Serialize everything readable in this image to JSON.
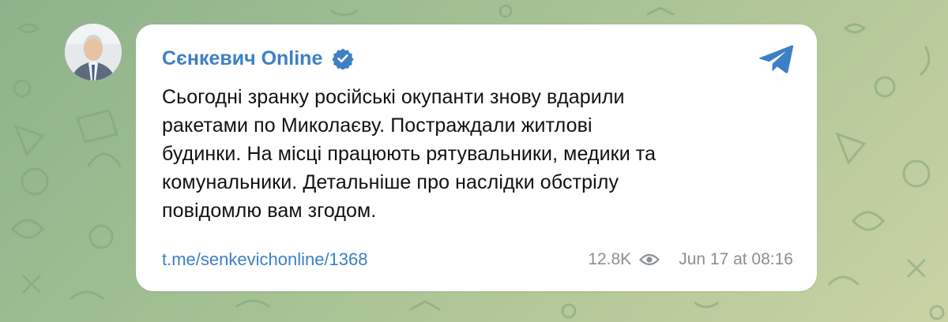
{
  "channel": {
    "name": "Сєнкевич Online",
    "avatar_icon": "person-avatar-icon",
    "verified_icon": "verified-badge-icon"
  },
  "message": {
    "text": "Сьогодні зранку російські окупанти знову вдарили\nракетами по Миколаєву. Постраждали житлові\nбудинки. На місці працюють рятувальники, медики та\nкомунальники. Детальніше про наслідки обстрілу\nповідомлю вам згодом."
  },
  "footer": {
    "link": "t.me/senkevichonline/1368",
    "views": "12.8K",
    "views_icon": "eye-icon",
    "timestamp": "Jun 17 at 08:16"
  },
  "header": {
    "app_icon": "telegram-icon"
  },
  "colors": {
    "accent": "#3c80c6",
    "meta_text": "#8a8f94",
    "message_text": "#111111",
    "bubble": "#ffffff",
    "background": "#9fbf92"
  }
}
